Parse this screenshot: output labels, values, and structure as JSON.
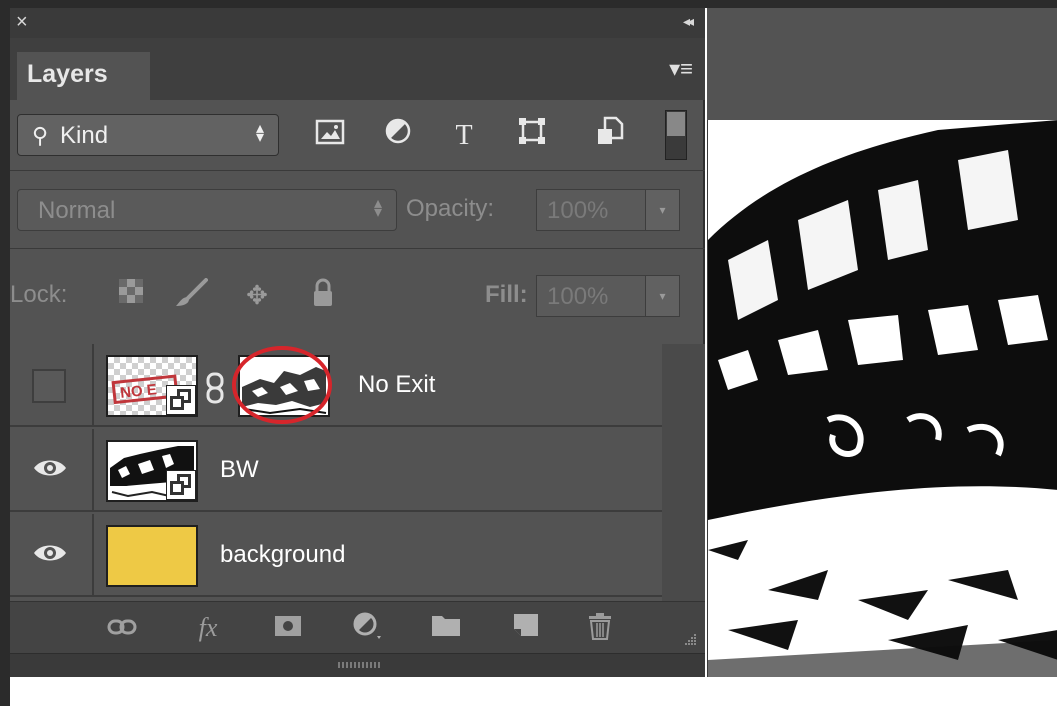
{
  "panel": {
    "title": "Layers",
    "close_glyph": "×",
    "collapse_glyph": "◂◂",
    "menu_glyph": "▾≡"
  },
  "filter": {
    "kind_label": "Kind",
    "icons": [
      "pixel-layer-filter-icon",
      "adjustment-layer-filter-icon",
      "type-layer-filter-icon",
      "shape-layer-filter-icon",
      "smart-object-filter-icon"
    ]
  },
  "blend": {
    "mode": "Normal",
    "opacity_label": "Opacity:",
    "opacity_value": "100%"
  },
  "lock": {
    "label": "Lock:",
    "fill_label": "Fill:",
    "fill_value": "100%"
  },
  "layers": [
    {
      "name": "No Exit",
      "visible": false,
      "thumbnail": "no-exit-sign",
      "has_mask": true
    },
    {
      "name": "BW",
      "visible": true,
      "thumbnail": "bw-graffiti"
    },
    {
      "name": "background",
      "visible": true,
      "thumbnail": "solid-fill",
      "fill_color": "#eec945"
    }
  ],
  "bottom_bar": {
    "icons": [
      "link-layers-icon",
      "fx-icon",
      "add-mask-icon",
      "adjustment-layer-icon",
      "new-group-icon",
      "new-layer-icon",
      "delete-layer-icon"
    ],
    "fx_label": "fx"
  },
  "colors": {
    "panel_bg": "#535353",
    "highlight_circle": "#d6252b"
  }
}
